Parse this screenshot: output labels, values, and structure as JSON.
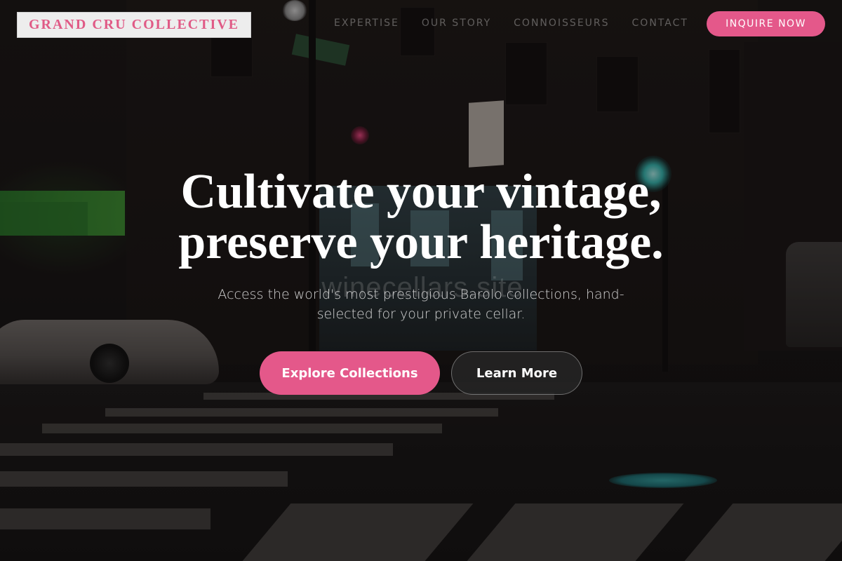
{
  "brand": {
    "name": "GRAND CRU COLLECTIVE",
    "accent": "#e4588a"
  },
  "nav": {
    "links": [
      "EXPERTISE",
      "OUR STORY",
      "CONNOISSEURS",
      "CONTACT"
    ],
    "cta": "INQUIRE NOW"
  },
  "hero": {
    "title_line1": "Cultivate your vintage,",
    "title_line2": "preserve your heritage.",
    "subtitle": "Access the world's most prestigious Barolo collections, hand-selected for your private cellar.",
    "primary_button": "Explore Collections",
    "secondary_button": "Learn More"
  },
  "background": {
    "watermark": "winecellars.site"
  }
}
